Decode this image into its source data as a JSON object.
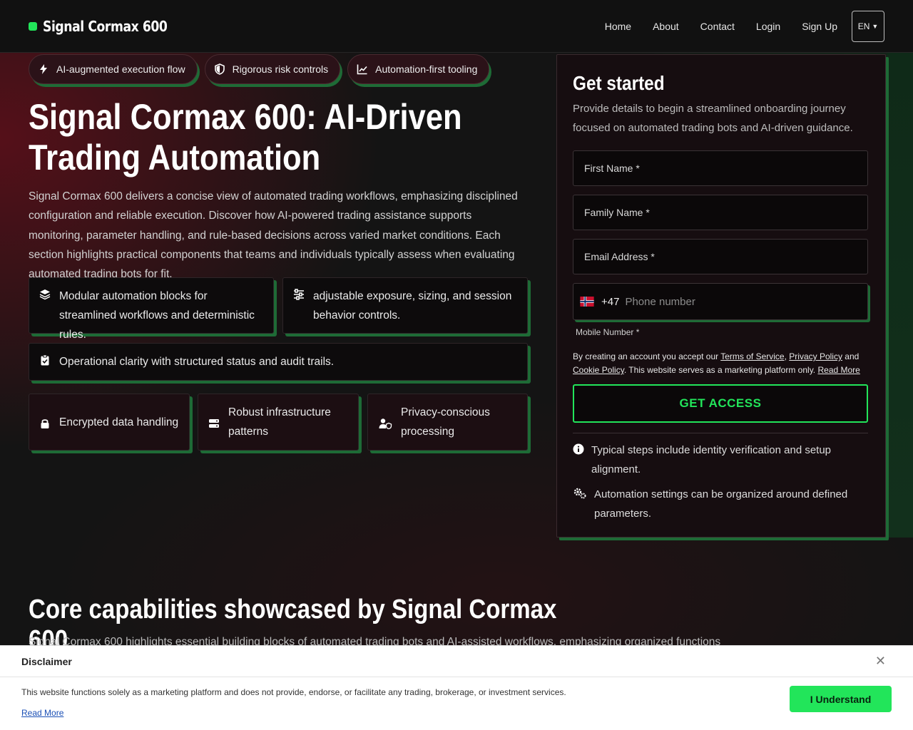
{
  "header": {
    "brand": "Signal Cormax 600",
    "nav": [
      "Home",
      "About",
      "Contact",
      "Login",
      "Sign Up"
    ],
    "lang": "EN"
  },
  "pills": [
    {
      "label": "AI-augmented execution flow",
      "icon": "bolt-icon"
    },
    {
      "label": "Rigorous risk controls",
      "icon": "shield-icon"
    },
    {
      "label": "Automation-first tooling",
      "icon": "chart-line-icon"
    }
  ],
  "hero": {
    "title": "Signal Cormax 600: AI-Driven Trading Automation",
    "description": "Signal Cormax 600 delivers a concise view of automated trading workflows, emphasizing disciplined configuration and reliable execution. Discover how AI-powered trading assistance supports monitoring, parameter handling, and rule-based decisions across varied market conditions. Each section highlights practical components that teams and individuals typically assess when evaluating automated trading bots for fit."
  },
  "features": [
    {
      "label": "Modular automation blocks for streamlined workflows and deterministic rules.",
      "icon": "layers-icon"
    },
    {
      "label": "adjustable exposure, sizing, and session behavior controls.",
      "icon": "sliders-icon"
    },
    {
      "label": "Operational clarity with structured status and audit trails.",
      "icon": "clipboard-check-icon"
    }
  ],
  "mini_features": [
    {
      "label": "Encrypted data handling",
      "icon": "lock-icon"
    },
    {
      "label": "Robust infrastructure patterns",
      "icon": "server-icon"
    },
    {
      "label": "Privacy-conscious processing",
      "icon": "user-shield-icon"
    }
  ],
  "form": {
    "title": "Get started",
    "subtitle": "Provide details to begin a streamlined onboarding journey focused on automated trading bots and AI-driven guidance.",
    "first_name": "First Name *",
    "family_name": "Family Name *",
    "email": "Email Address *",
    "phone_code": "+47",
    "phone_placeholder": "Phone number",
    "mobile_label": "Mobile Number *",
    "terms_prefix": "By creating an account you accept our ",
    "terms_link": "Terms of Service",
    "terms_sep": ", ",
    "privacy_link": "Privacy Policy",
    "terms_and": " and ",
    "cookie_link": "Cookie Policy",
    "terms_suffix": ". This website serves as a marketing platform only. ",
    "read_more": "Read More",
    "cta": "GET ACCESS",
    "notes": [
      "Typical steps include identity verification and setup alignment.",
      "Automation settings can be organized around defined parameters."
    ]
  },
  "section2": {
    "title": "Core capabilities showcased by Signal Cormax 600",
    "description": "Signal Cormax 600 highlights essential building blocks of automated trading bots and AI-assisted workflows, emphasizing organized functions"
  },
  "disclaimer": {
    "title": "Disclaimer",
    "text": "This website functions solely as a marketing platform and does not provide, endorse, or facilitate any trading, brokerage, or investment services.",
    "read_more": "Read More",
    "button": "I Understand",
    "close": "✕"
  },
  "colors": {
    "accent": "#22e55a",
    "background": "#131313",
    "card_shadow": "#1e6b36"
  }
}
